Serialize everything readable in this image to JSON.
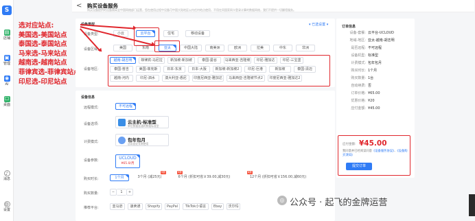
{
  "sidebar": {
    "logo": "S",
    "items": [
      {
        "label": "店铺",
        "icon": "store-icon",
        "color": "#33b36b"
      },
      {
        "label": "管理",
        "icon": "manage-icon",
        "color": "#2f7bf5"
      },
      {
        "label": "AI",
        "icon": "ai-icon",
        "color": "#2f7bf5"
      },
      {
        "label": "桌面",
        "icon": "desktop-icon",
        "color": "#33b36b"
      },
      {
        "label": "消息",
        "icon": "bell-icon",
        "color": "#888888"
      },
      {
        "label": "设置",
        "icon": "settings-icon",
        "color": "#888888"
      }
    ]
  },
  "annotation": [
    "选对应站点:",
    "美国选-美国站点",
    "泰国选-泰国站点",
    "马来选-马来站点",
    "越南选-越南站点",
    "菲律宾选-菲律宾站点",
    "印尼选-印尼站点"
  ],
  "header": {
    "back": "<",
    "title": "购买设备服务",
    "desc": "购买设备提供的设备隔离全中国网络部门运营，您在使用过程中设备可中国大陆地区以内任何地点使用，不用在同国家网卡登录计算的数据网络，我们不提供一切翻墙服务。"
  },
  "panel1": {
    "type_label": "设备类型:",
    "types": [
      "小云",
      "云平台",
      "住宅",
      "移动设备"
    ],
    "link": "已选设置",
    "region_label": "设备区域:",
    "regions": [
      "美国",
      "东南",
      "亚太",
      "中国大陆",
      "南美洲",
      "欧洲",
      "拉美",
      "中东",
      "非洲"
    ],
    "site_label": "设备地区:",
    "sites": [
      "越南-胡志明",
      "菲律宾-马尼拉",
      "新加坡-新加坡",
      "泰国-曼谷",
      "马来西亚-吉隆坡",
      "印尼-雅加达",
      "印尼-三宝垄",
      "泰国-普吉",
      "美国-菲克斯",
      "日本-东京",
      "日本-大阪",
      "新加坡-新加坡2",
      "印尼-巨港",
      "新加坡",
      "泰国-清迈",
      "越南-河内",
      "印尼-泗水",
      "澳大利亚-悉尼",
      "印度尼西亚-雅加达",
      "马来西亚-吉隆坡节点2",
      "印度尼西亚-雅加达2"
    ]
  },
  "panel2": {
    "sec": "设备信息",
    "sel_label": "远程模式:",
    "sel_value": "不可远程",
    "spec_label": "设备选项:",
    "spec_title": "云主机-标准型",
    "spec_sub": "单位数据连通的数据标准型",
    "bill_label": "计费模式:",
    "bill_title": "包年包月",
    "bill_sub": "适用固定长期使用",
    "cpu_label": "设备参数:",
    "cpu_value": "UCLOUD",
    "cpu_price": "¥65.0/月",
    "dur_label": "购买时长:",
    "durations": [
      "1个月",
      "3个月 (减25元)",
      "6个月 (折扣可省￥39.00,减30元)",
      "12个月 (折扣可省￥156.00,减60元)"
    ],
    "dur_tags": [
      "9折",
      "9折",
      "8折"
    ],
    "qty_label": "购买数量:",
    "qty_minus": "−",
    "qty_value": "1",
    "qty_plus": "+",
    "plat_label": "推荐平台:",
    "platforms": [
      "亚马逊",
      "速卖通",
      "Shopify",
      "PayPal",
      "TikTok小语言",
      "Ebay",
      "沃尔玛"
    ]
  },
  "order": {
    "title": "订单信息",
    "rows": [
      [
        "设备-套餐:",
        "云平台-UCLOUD"
      ],
      [
        "地域-地区:",
        "亚太-越南-胡志明"
      ],
      [
        "是否远程:",
        "不可远程"
      ],
      [
        "设备机型:",
        "标准型"
      ],
      [
        "计费模式:",
        "包年包月"
      ],
      [
        "购买时长:",
        "1个月"
      ],
      [
        "购买数量:",
        "1台"
      ],
      [
        "自动续费:",
        "否"
      ],
      [
        "订单价格:",
        "¥65.00"
      ],
      [
        "优惠价格:",
        "¥20"
      ],
      [
        "应付金额:",
        "¥45.00"
      ]
    ]
  },
  "pay": {
    "label": "应付金额:",
    "amount": "¥45.00",
    "note1": "我同意并已经阅读同意",
    "link1": "《设备服务协议》",
    "and": "、",
    "link2": "《设备购买须知》",
    "button": "提交订单"
  },
  "watermark": "公众号 · 起飞的金牌运营"
}
